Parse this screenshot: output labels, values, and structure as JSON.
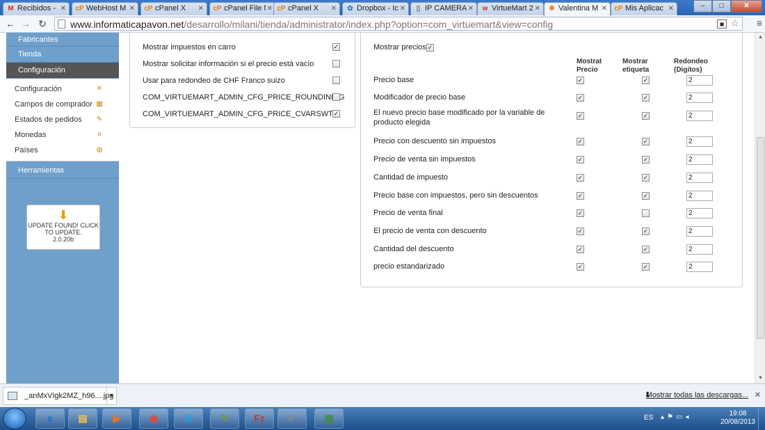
{
  "browser": {
    "tabs": [
      {
        "icon": "gmail-icon",
        "glyph": "M",
        "color": "#d93025",
        "title": "Recibidos - "
      },
      {
        "icon": "cpanel-icon",
        "glyph": "cP",
        "color": "#e87d0d",
        "title": "WebHost M"
      },
      {
        "icon": "cpanel-icon",
        "glyph": "cP",
        "color": "#e87d0d",
        "title": "cPanel X"
      },
      {
        "icon": "cpanel-icon",
        "glyph": "cP",
        "color": "#e87d0d",
        "title": "cPanel File M"
      },
      {
        "icon": "cpanel-icon",
        "glyph": "cP",
        "color": "#e87d0d",
        "title": "cPanel X"
      },
      {
        "icon": "dropbox-icon",
        "glyph": "✿",
        "color": "#2f77c9",
        "title": "Dropbox - Ic"
      },
      {
        "icon": "page-icon",
        "glyph": "▯",
        "color": "#666",
        "title": "IP CAMERA"
      },
      {
        "icon": "virtuemart-icon",
        "glyph": "w",
        "color": "#c0392b",
        "title": "VirtueMart 2"
      },
      {
        "icon": "joomla-icon",
        "glyph": "✱",
        "color": "#e67e22",
        "title": "Valentina M"
      },
      {
        "icon": "cpanel-icon",
        "glyph": "cP",
        "color": "#e87d0d",
        "title": "Mis Aplicac"
      }
    ],
    "url_host": "www.informaticapavon.net",
    "url_path": "/desarrollo/milani/tienda/administrator/index.php?option=com_virtuemart&view=config",
    "window_buttons": {
      "minimize": "–",
      "maximize": "□",
      "close": "✕"
    }
  },
  "sidebar": {
    "sections": {
      "fabricantes": "Fabricantes",
      "tienda": "Tienda",
      "configuracion": "Configuración",
      "herramientas": "Herramientas"
    },
    "items": [
      {
        "label": "Configuración",
        "icon": "tools-icon",
        "glyph": "✕"
      },
      {
        "label": "Campos de comprador",
        "icon": "form-icon",
        "glyph": "▦"
      },
      {
        "label": "Estados de pedidos",
        "icon": "status-icon",
        "glyph": "✎"
      },
      {
        "label": "Monedas",
        "icon": "coins-icon",
        "glyph": "¤"
      },
      {
        "label": "Países",
        "icon": "globe-icon",
        "glyph": "◍"
      }
    ],
    "update": {
      "line1": "UPDATE FOUND! CLICK",
      "line2": "TO UPDATE.",
      "version": "2.0.20b"
    }
  },
  "left_panel": {
    "rows": [
      {
        "label": "Mostrar impuestos en carro",
        "checked": true
      },
      {
        "label": "Mostrar solicitar información si el precio está vacío",
        "checked": false
      },
      {
        "label": "Usar para redondeo de CHF Franco suizo",
        "checked": false
      },
      {
        "label": "COM_VIRTUEMART_ADMIN_CFG_PRICE_ROUNDINDIG",
        "checked": false
      },
      {
        "label": "COM_VIRTUEMART_ADMIN_CFG_PRICE_CVARSWT",
        "checked": true
      }
    ]
  },
  "right_panel": {
    "show_prices_label": "Mostrar precios",
    "show_prices_checked": true,
    "headers": {
      "col1_line1": "Mostrat",
      "col1_line2": "Precio",
      "col2_line1": "Mostrar",
      "col2_line2": "etiqueta",
      "col3_line1": "Redondeo",
      "col3_line2": "(Digitos)"
    },
    "rows": [
      {
        "label": "Precio base",
        "show_price": true,
        "show_label": true,
        "round": "2"
      },
      {
        "label": "Modificador de precio base",
        "show_price": true,
        "show_label": true,
        "round": "2"
      },
      {
        "label": "El nuevo precio base modificado por la variable de producto elegida",
        "show_price": true,
        "show_label": true,
        "round": "2"
      },
      {
        "label": "Precio con descuento sin impuestos",
        "show_price": true,
        "show_label": true,
        "round": "2"
      },
      {
        "label": "Precio de venta sin impuestos",
        "show_price": true,
        "show_label": true,
        "round": "2"
      },
      {
        "label": "Cantidad de impuesto",
        "show_price": true,
        "show_label": true,
        "round": "2"
      },
      {
        "label": "Precio base con impuestos, pero sin descuentos",
        "show_price": true,
        "show_label": true,
        "round": "2"
      },
      {
        "label": "Precio de venta final",
        "show_price": true,
        "show_label": false,
        "round": "2"
      },
      {
        "label": "El precio de venta con descuento",
        "show_price": true,
        "show_label": true,
        "round": "2"
      },
      {
        "label": "Cantidad del descuento",
        "show_price": true,
        "show_label": true,
        "round": "2"
      },
      {
        "label": "precio estandarizado",
        "show_price": true,
        "show_label": true,
        "round": "2"
      }
    ]
  },
  "downloads": {
    "file_name": "_anMxVIgk2MZ_h96....jpg",
    "show_all": "Mostrar todas las descargas..."
  },
  "taskbar": {
    "language": "ES",
    "time": "19:08",
    "date": "20/08/2013",
    "apps": [
      {
        "name": "ie-icon",
        "glyph": "e"
      },
      {
        "name": "explorer-icon",
        "glyph": "▤"
      },
      {
        "name": "media-player-icon",
        "glyph": "▶"
      },
      {
        "name": "chrome-icon",
        "glyph": "◉"
      },
      {
        "name": "skype-icon",
        "glyph": "S"
      },
      {
        "name": "paint-icon",
        "glyph": "✎"
      },
      {
        "name": "filezilla-icon",
        "glyph": "Fz"
      },
      {
        "name": "paintbrush-icon",
        "glyph": "✐"
      },
      {
        "name": "chart-app-icon",
        "glyph": "▥"
      }
    ]
  }
}
